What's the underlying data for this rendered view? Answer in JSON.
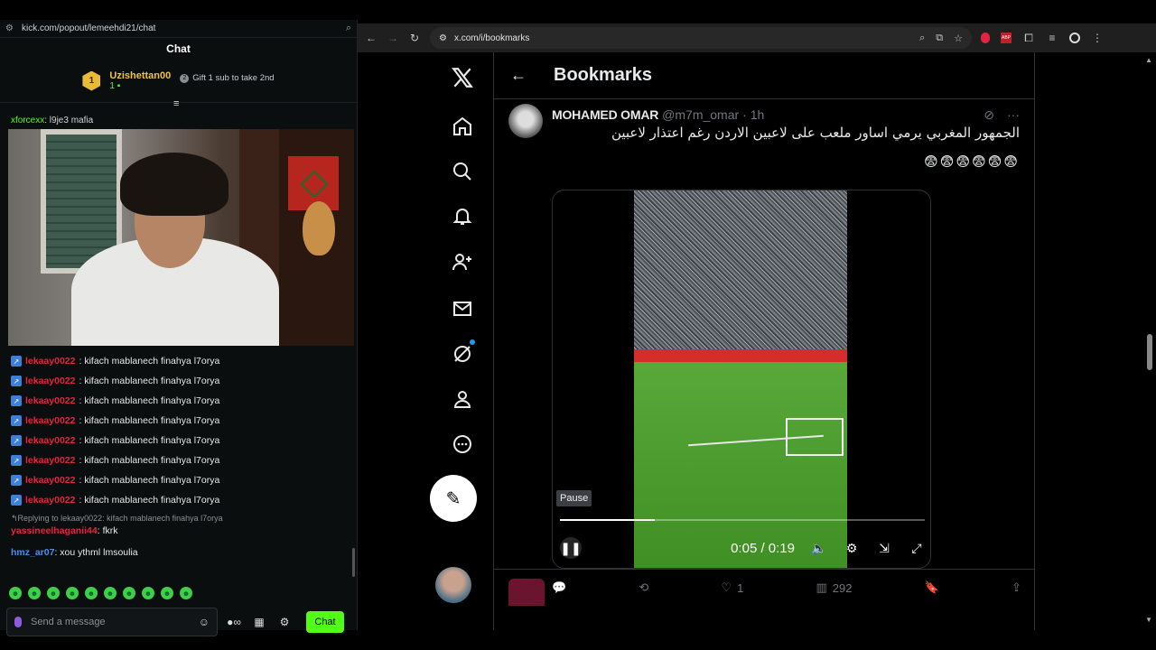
{
  "left_window": {
    "url": "kick.com/popout/lemeehdi21/chat",
    "header": "Chat",
    "leaderboard": {
      "rank": "1",
      "name": "Uzishettan00",
      "count": "1",
      "gift_text": "Gift 1 sub to take 2nd"
    },
    "top_partial_message": {
      "user": "xforcexx",
      "text": ": l9je3 mafia"
    },
    "messages": [
      {
        "user": "lekaay0022",
        "text": ": kifach mablanech finahya l7orya"
      },
      {
        "user": "lekaay0022",
        "text": ": kifach mablanech finahya l7orya"
      },
      {
        "user": "lekaay0022",
        "text": ": kifach mablanech finahya l7orya"
      },
      {
        "user": "lekaay0022",
        "text": ": kifach mablanech finahya l7orya"
      },
      {
        "user": "lekaay0022",
        "text": ": kifach mablanech finahya l7orya"
      },
      {
        "user": "lekaay0022",
        "text": ": kifach mablanech finahya l7orya"
      },
      {
        "user": "lekaay0022",
        "text": ": kifach mablanech finahya l7orya"
      },
      {
        "user": "lekaay0022",
        "text": ": kifach mablanech finahya l7orya"
      }
    ],
    "reply_context": "Replying to lekaay0022: kifach mablanech finahya l7orya",
    "reply_message": {
      "user": "yassineelhaganii44",
      "text": ": fkrk"
    },
    "last_message": {
      "user": "hmz_ar07",
      "text": ": xou ythml lmsoulia"
    },
    "input_placeholder": "Send a message",
    "chat_button": "Chat"
  },
  "browser": {
    "url": "x.com/i/bookmarks"
  },
  "x_page": {
    "title": "Bookmarks",
    "tweet": {
      "name": "MOHAMED OMAR",
      "handle": "@m7m_omar",
      "time": "· 1h",
      "text": "الجمهور المغربي يرمي اساور ملعب على لاعبين الاردن رغم اعتذار لاعبين",
      "emojis": "😨😨😨😨😨😨",
      "video": {
        "tooltip": "Pause",
        "current_time": "0:05",
        "duration": "0:19",
        "time_display": "0:05 / 0:19",
        "progress": 0.26
      },
      "likes": "1",
      "views": "292"
    }
  }
}
